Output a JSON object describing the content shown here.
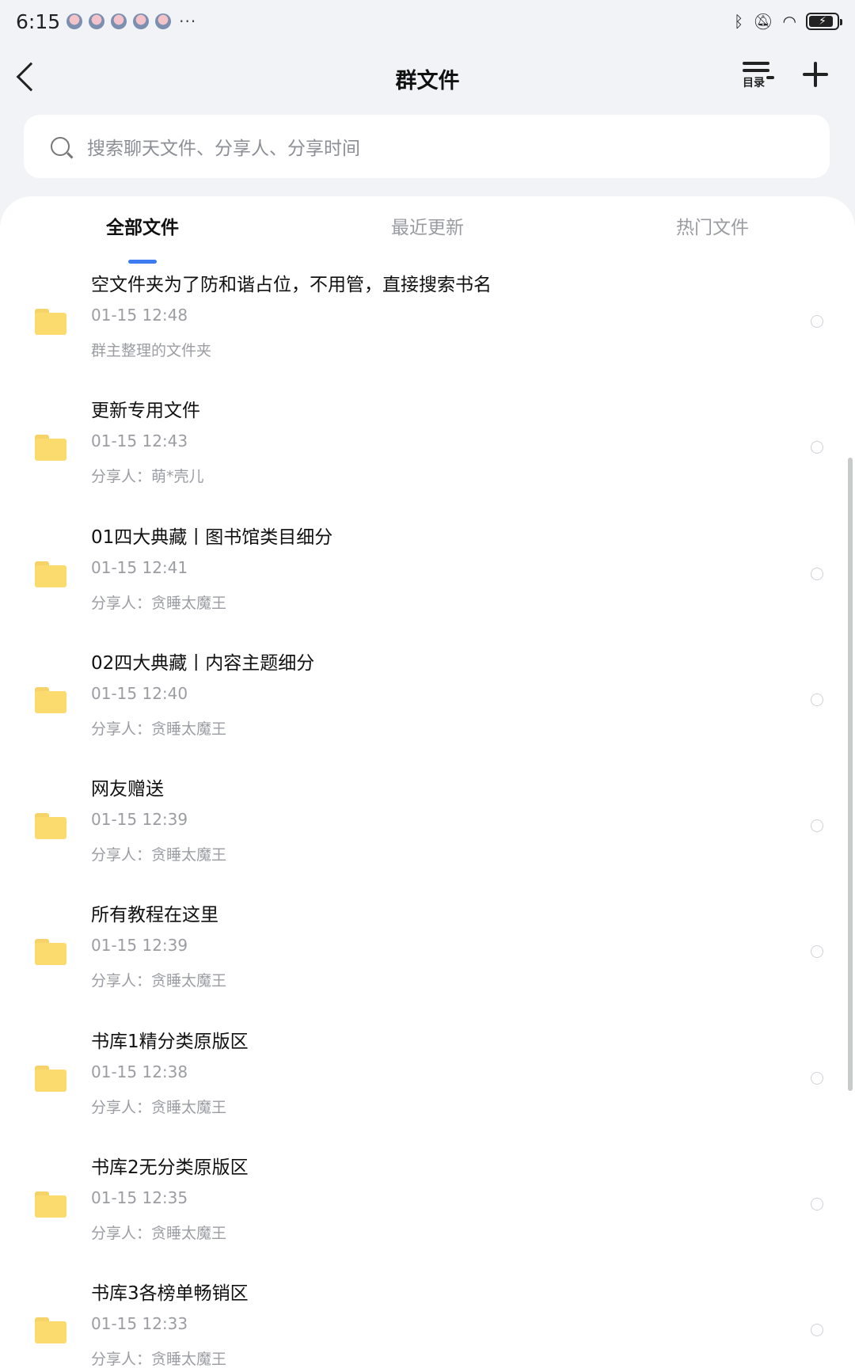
{
  "status_bar": {
    "time": "6:15",
    "more": "···",
    "icons": [
      "bluetooth-icon",
      "bell-off-icon",
      "wifi-icon",
      "battery-charging-icon"
    ]
  },
  "nav": {
    "title": "群文件",
    "catalog_label": "目录"
  },
  "search": {
    "placeholder": "搜索聊天文件、分享人、分享时间"
  },
  "tabs": [
    {
      "label": "全部文件",
      "active": true
    },
    {
      "label": "最近更新",
      "active": false
    },
    {
      "label": "热门文件",
      "active": false
    }
  ],
  "files": [
    {
      "name": "空文件夹为了防和谐占位，不用管，直接搜索书名",
      "date": "01-15  12:48",
      "meta": "群主整理的文件夹"
    },
    {
      "name": "更新专用文件",
      "date": "01-15  12:43",
      "meta": "分享人：萌*壳儿"
    },
    {
      "name": "01四大典藏丨图书馆类目细分",
      "date": "01-15  12:41",
      "meta": "分享人：贪睡太魔王"
    },
    {
      "name": "02四大典藏丨内容主题细分",
      "date": "01-15  12:40",
      "meta": "分享人：贪睡太魔王"
    },
    {
      "name": "网友赠送",
      "date": "01-15  12:39",
      "meta": "分享人：贪睡太魔王"
    },
    {
      "name": "所有教程在这里",
      "date": "01-15  12:39",
      "meta": "分享人：贪睡太魔王"
    },
    {
      "name": "书库1精分类原版区",
      "date": "01-15  12:38",
      "meta": "分享人：贪睡太魔王"
    },
    {
      "name": "书库2无分类原版区",
      "date": "01-15  12:35",
      "meta": "分享人：贪睡太魔王"
    },
    {
      "name": "书库3各榜单畅销区",
      "date": "01-15  12:33",
      "meta": "分享人：贪睡太魔王"
    }
  ],
  "colors": {
    "accent": "#3d7bf3",
    "folder": "#fbda6e",
    "background": "#f2f3f7"
  }
}
